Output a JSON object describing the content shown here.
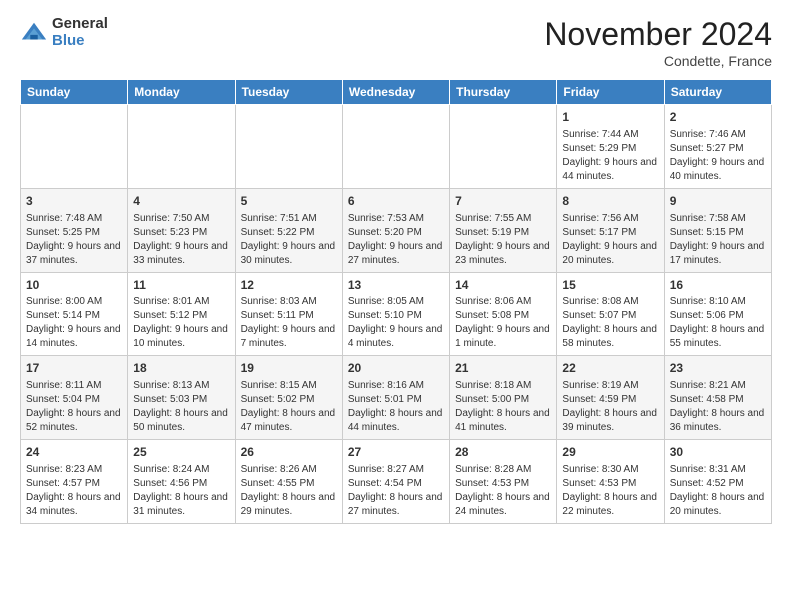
{
  "header": {
    "logo_general": "General",
    "logo_blue": "Blue",
    "month_title": "November 2024",
    "subtitle": "Condette, France"
  },
  "weekdays": [
    "Sunday",
    "Monday",
    "Tuesday",
    "Wednesday",
    "Thursday",
    "Friday",
    "Saturday"
  ],
  "weeks": [
    [
      {
        "day": "",
        "info": ""
      },
      {
        "day": "",
        "info": ""
      },
      {
        "day": "",
        "info": ""
      },
      {
        "day": "",
        "info": ""
      },
      {
        "day": "",
        "info": ""
      },
      {
        "day": "1",
        "info": "Sunrise: 7:44 AM\nSunset: 5:29 PM\nDaylight: 9 hours and 44 minutes."
      },
      {
        "day": "2",
        "info": "Sunrise: 7:46 AM\nSunset: 5:27 PM\nDaylight: 9 hours and 40 minutes."
      }
    ],
    [
      {
        "day": "3",
        "info": "Sunrise: 7:48 AM\nSunset: 5:25 PM\nDaylight: 9 hours and 37 minutes."
      },
      {
        "day": "4",
        "info": "Sunrise: 7:50 AM\nSunset: 5:23 PM\nDaylight: 9 hours and 33 minutes."
      },
      {
        "day": "5",
        "info": "Sunrise: 7:51 AM\nSunset: 5:22 PM\nDaylight: 9 hours and 30 minutes."
      },
      {
        "day": "6",
        "info": "Sunrise: 7:53 AM\nSunset: 5:20 PM\nDaylight: 9 hours and 27 minutes."
      },
      {
        "day": "7",
        "info": "Sunrise: 7:55 AM\nSunset: 5:19 PM\nDaylight: 9 hours and 23 minutes."
      },
      {
        "day": "8",
        "info": "Sunrise: 7:56 AM\nSunset: 5:17 PM\nDaylight: 9 hours and 20 minutes."
      },
      {
        "day": "9",
        "info": "Sunrise: 7:58 AM\nSunset: 5:15 PM\nDaylight: 9 hours and 17 minutes."
      }
    ],
    [
      {
        "day": "10",
        "info": "Sunrise: 8:00 AM\nSunset: 5:14 PM\nDaylight: 9 hours and 14 minutes."
      },
      {
        "day": "11",
        "info": "Sunrise: 8:01 AM\nSunset: 5:12 PM\nDaylight: 9 hours and 10 minutes."
      },
      {
        "day": "12",
        "info": "Sunrise: 8:03 AM\nSunset: 5:11 PM\nDaylight: 9 hours and 7 minutes."
      },
      {
        "day": "13",
        "info": "Sunrise: 8:05 AM\nSunset: 5:10 PM\nDaylight: 9 hours and 4 minutes."
      },
      {
        "day": "14",
        "info": "Sunrise: 8:06 AM\nSunset: 5:08 PM\nDaylight: 9 hours and 1 minute."
      },
      {
        "day": "15",
        "info": "Sunrise: 8:08 AM\nSunset: 5:07 PM\nDaylight: 8 hours and 58 minutes."
      },
      {
        "day": "16",
        "info": "Sunrise: 8:10 AM\nSunset: 5:06 PM\nDaylight: 8 hours and 55 minutes."
      }
    ],
    [
      {
        "day": "17",
        "info": "Sunrise: 8:11 AM\nSunset: 5:04 PM\nDaylight: 8 hours and 52 minutes."
      },
      {
        "day": "18",
        "info": "Sunrise: 8:13 AM\nSunset: 5:03 PM\nDaylight: 8 hours and 50 minutes."
      },
      {
        "day": "19",
        "info": "Sunrise: 8:15 AM\nSunset: 5:02 PM\nDaylight: 8 hours and 47 minutes."
      },
      {
        "day": "20",
        "info": "Sunrise: 8:16 AM\nSunset: 5:01 PM\nDaylight: 8 hours and 44 minutes."
      },
      {
        "day": "21",
        "info": "Sunrise: 8:18 AM\nSunset: 5:00 PM\nDaylight: 8 hours and 41 minutes."
      },
      {
        "day": "22",
        "info": "Sunrise: 8:19 AM\nSunset: 4:59 PM\nDaylight: 8 hours and 39 minutes."
      },
      {
        "day": "23",
        "info": "Sunrise: 8:21 AM\nSunset: 4:58 PM\nDaylight: 8 hours and 36 minutes."
      }
    ],
    [
      {
        "day": "24",
        "info": "Sunrise: 8:23 AM\nSunset: 4:57 PM\nDaylight: 8 hours and 34 minutes."
      },
      {
        "day": "25",
        "info": "Sunrise: 8:24 AM\nSunset: 4:56 PM\nDaylight: 8 hours and 31 minutes."
      },
      {
        "day": "26",
        "info": "Sunrise: 8:26 AM\nSunset: 4:55 PM\nDaylight: 8 hours and 29 minutes."
      },
      {
        "day": "27",
        "info": "Sunrise: 8:27 AM\nSunset: 4:54 PM\nDaylight: 8 hours and 27 minutes."
      },
      {
        "day": "28",
        "info": "Sunrise: 8:28 AM\nSunset: 4:53 PM\nDaylight: 8 hours and 24 minutes."
      },
      {
        "day": "29",
        "info": "Sunrise: 8:30 AM\nSunset: 4:53 PM\nDaylight: 8 hours and 22 minutes."
      },
      {
        "day": "30",
        "info": "Sunrise: 8:31 AM\nSunset: 4:52 PM\nDaylight: 8 hours and 20 minutes."
      }
    ]
  ]
}
